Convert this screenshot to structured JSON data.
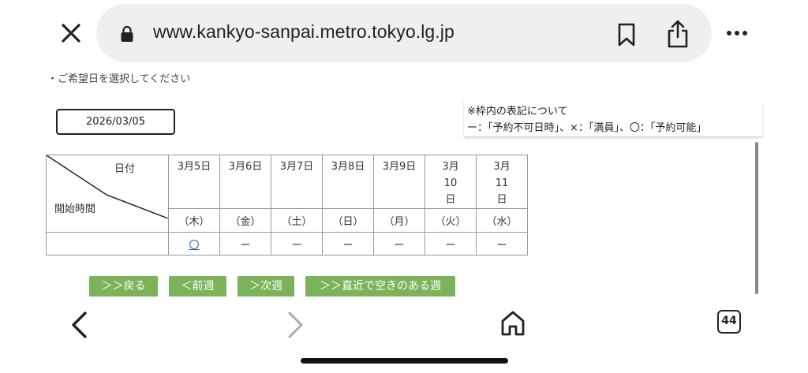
{
  "browser": {
    "url": "www.kankyo-sanpai.metro.tokyo.lg.jp",
    "tab_count": "44"
  },
  "page": {
    "instruction": "・ご希望日を選択してください",
    "date_value": "2026/03/05",
    "legend": {
      "title": "※枠内の表記について",
      "text": "ー：「予約不可日時」、×：「満員」、〇：「予約可能」"
    },
    "table": {
      "header_date": "日付",
      "header_time": "開始時間",
      "days": [
        {
          "date": "3月5日",
          "weekday": "（木）",
          "status": "〇"
        },
        {
          "date": "3月6日",
          "weekday": "（金）",
          "status": "ー"
        },
        {
          "date": "3月7日",
          "weekday": "（土）",
          "status": "ー"
        },
        {
          "date": "3月8日",
          "weekday": "（日）",
          "status": "ー"
        },
        {
          "date": "3月9日",
          "weekday": "（月）",
          "status": "ー"
        },
        {
          "date": "3月10日",
          "weekday": "（火）",
          "status": "ー"
        },
        {
          "date": "3月11日",
          "weekday": "（水）",
          "status": "ー"
        }
      ]
    },
    "buttons": {
      "back": "＞＞戻る",
      "prev_week": "＜前週",
      "next_week": "＞次週",
      "nearest_week": "＞＞直近で空きのある週"
    }
  },
  "colors": {
    "button_green": "#7cb35a",
    "link_blue": "#1a5fb4",
    "urlbar_bg": "#efeff1"
  }
}
